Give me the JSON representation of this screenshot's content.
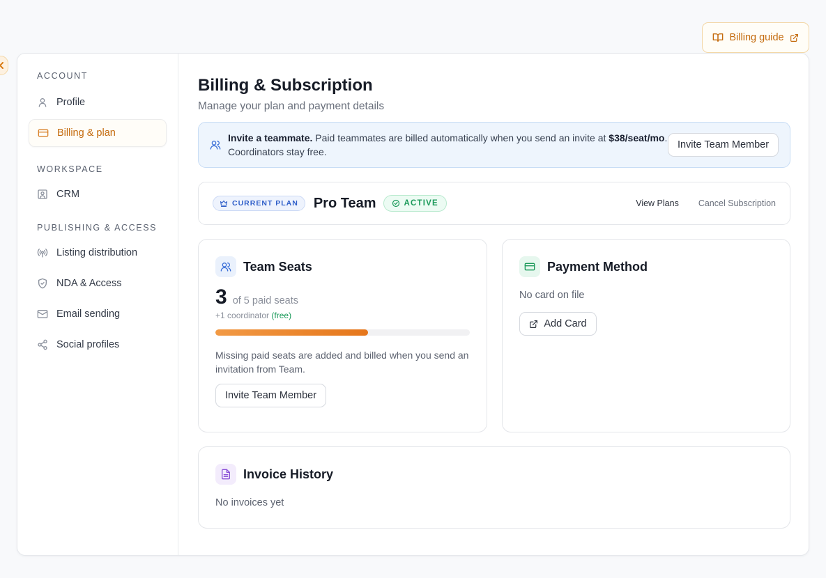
{
  "header": {
    "guide_label": "Billing guide"
  },
  "sidebar": {
    "sections": [
      {
        "title": "ACCOUNT",
        "items": [
          {
            "label": "Profile",
            "icon": "user-icon"
          },
          {
            "label": "Billing & plan",
            "icon": "credit-card-icon",
            "active": true
          }
        ]
      },
      {
        "title": "WORKSPACE",
        "items": [
          {
            "label": "CRM",
            "icon": "contact-card-icon"
          }
        ]
      },
      {
        "title": "PUBLISHING & ACCESS",
        "items": [
          {
            "label": "Listing distribution",
            "icon": "broadcast-icon"
          },
          {
            "label": "NDA & Access",
            "icon": "shield-icon"
          },
          {
            "label": "Email sending",
            "icon": "mail-icon"
          },
          {
            "label": "Social profiles",
            "icon": "share-icon"
          }
        ]
      }
    ]
  },
  "page": {
    "title": "Billing & Subscription",
    "subtitle": "Manage your plan and payment details"
  },
  "invite_banner": {
    "bold_lead": "Invite a teammate.",
    "text_a": " Paid teammates are billed automatically when you send an invite at ",
    "price": "$38/seat/mo",
    "text_b": ". Coordinators stay free.",
    "button_label": "Invite Team Member"
  },
  "plan": {
    "badge_label": "CURRENT PLAN",
    "name": "Pro Team",
    "status_label": "ACTIVE",
    "view_plans_label": "View Plans",
    "cancel_label": "Cancel Subscription"
  },
  "team_seats": {
    "title": "Team Seats",
    "used": "3",
    "of_text": "of 5 paid seats",
    "coordinator_text": "+1 coordinator",
    "coordinator_free": "(free)",
    "progress_fraction": 0.6,
    "note": "Missing paid seats are added and billed when you send an invitation from Team.",
    "button_label": "Invite Team Member"
  },
  "payment_method": {
    "title": "Payment Method",
    "status": "No card on file",
    "button_label": "Add Card"
  },
  "invoice_history": {
    "title": "Invoice History",
    "status": "No invoices yet"
  },
  "colors": {
    "accent": "#d9822b",
    "info_blue": "#3a6fd8",
    "success": "#1b9a5a"
  }
}
